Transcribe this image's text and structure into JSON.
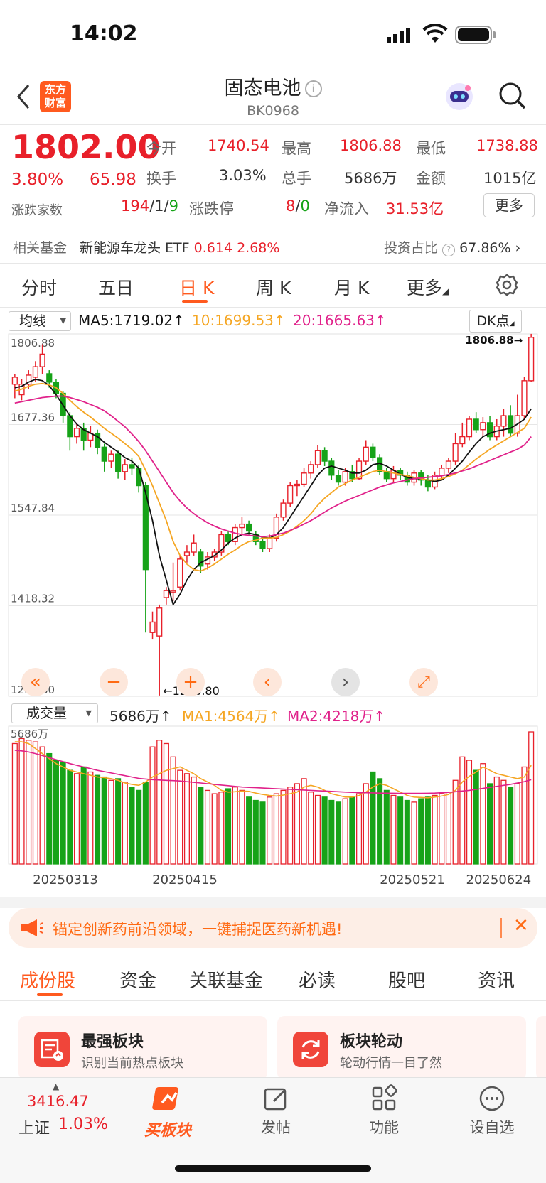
{
  "status_bar": {
    "time": "14:02"
  },
  "header": {
    "logo_line1": "东方",
    "logo_line2": "财富",
    "title": "固态电池",
    "code": "BK0968"
  },
  "quote": {
    "price": "1802.00",
    "change_pct": "3.80%",
    "change": "65.98",
    "open_label": "今开",
    "open": "1740.54",
    "high_label": "最高",
    "high": "1806.88",
    "low_label": "最低",
    "low": "1738.88",
    "turnover_label": "换手",
    "turnover": "3.03%",
    "volume_label": "总手",
    "volume": "5686万",
    "amount_label": "金额",
    "amount": "1015亿",
    "breadth_label": "涨跌家数",
    "breadth_up": "194",
    "breadth_sep1": "/",
    "breadth_flat": "1",
    "breadth_sep2": "/",
    "breadth_down": "9",
    "limit_label": "涨跌停",
    "limit_up": "8",
    "limit_sep": "/",
    "limit_down": "0",
    "netflow_label": "净流入",
    "netflow": "31.53亿",
    "more_button": "更多"
  },
  "fund_row": {
    "label": "相关基金",
    "fund_name": "新能源车龙头 ETF",
    "fund_price": "0.614",
    "fund_change": "2.68%",
    "ratio_label": "投资占比",
    "ratio": "67.86%"
  },
  "period_tabs": [
    "分时",
    "五日",
    "日 K",
    "周 K",
    "月 K",
    "更多"
  ],
  "ma_row": {
    "selector": "均线",
    "ma5": "MA5:1719.02",
    "ma10": "10:1699.53",
    "ma20": "20:1665.63",
    "dk_button": "DK点"
  },
  "vol_row": {
    "selector": "成交量",
    "vol": "5686万",
    "ma1": "MA1:4564万",
    "ma2": "MA2:4218万"
  },
  "colors": {
    "up": "#e8202a",
    "down": "#16a318",
    "ma5": "#111111",
    "ma10": "#f5a623",
    "ma20": "#e0218a",
    "brand": "#ff6a13"
  },
  "chart_data": {
    "type": "candlestick",
    "y_ticks": [
      "1806.88",
      "1677.36",
      "1547.84",
      "1418.32",
      "1288.80"
    ],
    "ylim": [
      1288.8,
      1806.88
    ],
    "high_label": "1806.88",
    "low_label": "1288.80",
    "x_ticks": [
      "20250313",
      "20250415",
      "20250521",
      "20250624"
    ],
    "candles": [
      [
        1735,
        1745,
        1715,
        1750
      ],
      [
        1720,
        1735,
        1712,
        1742
      ],
      [
        1735,
        1748,
        1728,
        1755
      ],
      [
        1745,
        1760,
        1738,
        1768
      ],
      [
        1760,
        1778,
        1750,
        1792
      ],
      [
        1750,
        1738,
        1730,
        1755
      ],
      [
        1738,
        1722,
        1715,
        1742
      ],
      [
        1722,
        1690,
        1680,
        1725
      ],
      [
        1690,
        1660,
        1640,
        1695
      ],
      [
        1660,
        1672,
        1650,
        1680
      ],
      [
        1672,
        1655,
        1640,
        1680
      ],
      [
        1655,
        1665,
        1645,
        1675
      ],
      [
        1665,
        1645,
        1635,
        1670
      ],
      [
        1645,
        1625,
        1610,
        1650
      ],
      [
        1625,
        1635,
        1615,
        1640
      ],
      [
        1635,
        1610,
        1600,
        1640
      ],
      [
        1610,
        1620,
        1598,
        1628
      ],
      [
        1620,
        1615,
        1605,
        1630
      ],
      [
        1615,
        1590,
        1580,
        1620
      ],
      [
        1590,
        1470,
        1380,
        1595
      ],
      [
        1380,
        1395,
        1370,
        1410
      ],
      [
        1375,
        1415,
        1290,
        1420
      ],
      [
        1430,
        1440,
        1420,
        1445
      ],
      [
        1440,
        1440,
        1425,
        1480
      ],
      [
        1445,
        1485,
        1440,
        1490
      ],
      [
        1490,
        1495,
        1480,
        1505
      ],
      [
        1495,
        1508,
        1490,
        1520
      ],
      [
        1495,
        1475,
        1465,
        1500
      ],
      [
        1478,
        1488,
        1470,
        1495
      ],
      [
        1488,
        1495,
        1482,
        1500
      ],
      [
        1495,
        1520,
        1490,
        1525
      ],
      [
        1520,
        1510,
        1505,
        1525
      ],
      [
        1510,
        1530,
        1505,
        1535
      ],
      [
        1530,
        1535,
        1520,
        1545
      ],
      [
        1535,
        1525,
        1520,
        1540
      ],
      [
        1520,
        1510,
        1505,
        1525
      ],
      [
        1510,
        1500,
        1495,
        1515
      ],
      [
        1500,
        1515,
        1495,
        1520
      ],
      [
        1515,
        1545,
        1510,
        1550
      ],
      [
        1545,
        1565,
        1540,
        1570
      ],
      [
        1565,
        1590,
        1560,
        1595
      ],
      [
        1590,
        1592,
        1575,
        1598
      ],
      [
        1592,
        1608,
        1588,
        1615
      ],
      [
        1608,
        1620,
        1600,
        1625
      ],
      [
        1620,
        1640,
        1615,
        1648
      ],
      [
        1640,
        1625,
        1618,
        1645
      ],
      [
        1625,
        1605,
        1598,
        1630
      ],
      [
        1605,
        1595,
        1590,
        1612
      ],
      [
        1595,
        1610,
        1590,
        1615
      ],
      [
        1610,
        1600,
        1595,
        1620
      ],
      [
        1600,
        1625,
        1598,
        1630
      ],
      [
        1625,
        1645,
        1620,
        1655
      ],
      [
        1645,
        1630,
        1625,
        1650
      ],
      [
        1630,
        1610,
        1605,
        1635
      ],
      [
        1610,
        1600,
        1595,
        1615
      ],
      [
        1600,
        1612,
        1595,
        1618
      ],
      [
        1612,
        1605,
        1598,
        1615
      ],
      [
        1605,
        1595,
        1590,
        1610
      ],
      [
        1595,
        1608,
        1590,
        1612
      ],
      [
        1608,
        1598,
        1590,
        1612
      ],
      [
        1598,
        1588,
        1582,
        1605
      ],
      [
        1588,
        1605,
        1585,
        1610
      ],
      [
        1605,
        1615,
        1600,
        1620
      ],
      [
        1615,
        1625,
        1608,
        1630
      ],
      [
        1625,
        1650,
        1620,
        1665
      ],
      [
        1650,
        1660,
        1645,
        1680
      ],
      [
        1660,
        1685,
        1655,
        1690
      ],
      [
        1685,
        1670,
        1665,
        1695
      ],
      [
        1670,
        1680,
        1660,
        1688
      ],
      [
        1680,
        1660,
        1655,
        1690
      ],
      [
        1660,
        1675,
        1655,
        1685
      ],
      [
        1675,
        1690,
        1660,
        1700
      ],
      [
        1690,
        1665,
        1660,
        1705
      ],
      [
        1665,
        1690,
        1660,
        1720
      ],
      [
        1690,
        1740,
        1685,
        1745
      ],
      [
        1740,
        1802,
        1738,
        1807
      ]
    ],
    "ma5": [
      1730,
      1732,
      1738,
      1742,
      1740,
      1733,
      1720,
      1705,
      1690,
      1678,
      1670,
      1665,
      1660,
      1652,
      1645,
      1638,
      1630,
      1625,
      1615,
      1580,
      1540,
      1490,
      1455,
      1420,
      1435,
      1455,
      1470,
      1480,
      1485,
      1490,
      1498,
      1508,
      1515,
      1520,
      1522,
      1520,
      1516,
      1515,
      1520,
      1530,
      1545,
      1560,
      1575,
      1590,
      1605,
      1615,
      1618,
      1615,
      1612,
      1608,
      1608,
      1612,
      1620,
      1622,
      1618,
      1612,
      1606,
      1602,
      1600,
      1600,
      1598,
      1596,
      1598,
      1605,
      1615,
      1625,
      1638,
      1650,
      1660,
      1665,
      1668,
      1670,
      1672,
      1678,
      1685,
      1700
    ],
    "ma10": [
      1725,
      1728,
      1732,
      1735,
      1736,
      1734,
      1730,
      1722,
      1712,
      1703,
      1695,
      1688,
      1680,
      1672,
      1665,
      1658,
      1650,
      1642,
      1632,
      1612,
      1590,
      1565,
      1540,
      1510,
      1490,
      1478,
      1470,
      1468,
      1472,
      1478,
      1485,
      1492,
      1498,
      1505,
      1510,
      1512,
      1515,
      1515,
      1516,
      1520,
      1525,
      1532,
      1540,
      1550,
      1562,
      1572,
      1580,
      1588,
      1593,
      1598,
      1602,
      1606,
      1610,
      1612,
      1610,
      1608,
      1606,
      1604,
      1602,
      1600,
      1598,
      1598,
      1600,
      1603,
      1607,
      1612,
      1620,
      1628,
      1635,
      1642,
      1648,
      1654,
      1660,
      1666,
      1672,
      1688
    ],
    "ma20": [
      1708,
      1710,
      1712,
      1714,
      1716,
      1717,
      1718,
      1718,
      1716,
      1713,
      1710,
      1706,
      1702,
      1697,
      1690,
      1682,
      1674,
      1664,
      1653,
      1640,
      1625,
      1610,
      1595,
      1580,
      1568,
      1558,
      1550,
      1543,
      1537,
      1532,
      1528,
      1525,
      1522,
      1520,
      1519,
      1518,
      1517,
      1518,
      1520,
      1522,
      1526,
      1530,
      1535,
      1540,
      1546,
      1552,
      1558,
      1563,
      1568,
      1572,
      1576,
      1580,
      1584,
      1588,
      1591,
      1594,
      1596,
      1598,
      1600,
      1601,
      1602,
      1603,
      1604,
      1606,
      1608,
      1611,
      1614,
      1618,
      1622,
      1626,
      1630,
      1634,
      1638,
      1642,
      1648,
      1660
    ],
    "volumes": [
      3600,
      3750,
      3700,
      3650,
      3500,
      3300,
      3100,
      3050,
      2800,
      2700,
      2900,
      2750,
      2650,
      2600,
      2500,
      2550,
      2450,
      2300,
      2200,
      2450,
      3500,
      3700,
      3600,
      3200,
      2800,
      2700,
      2600,
      2300,
      2200,
      2100,
      2150,
      2250,
      2300,
      2200,
      2000,
      1900,
      1850,
      2000,
      2100,
      2200,
      2300,
      2400,
      2550,
      2150,
      2050,
      2000,
      1900,
      1850,
      1950,
      2000,
      2100,
      2400,
      2750,
      2550,
      2200,
      2050,
      2000,
      1900,
      1850,
      1950,
      2000,
      2050,
      2100,
      2150,
      2500,
      3200,
      3100,
      2800,
      3000,
      2400,
      2600,
      2500,
      2300,
      2400,
      2900,
      3950
    ],
    "vol_max": 3950,
    "vol_max_label": "5686万",
    "vol_ma1": [
      3650,
      3650,
      3600,
      3450,
      3300,
      3150,
      3000,
      2900,
      2800,
      2750,
      2700,
      2650,
      2600,
      2580,
      2550,
      2500,
      2420,
      2380,
      2350,
      2450,
      2600,
      2700,
      2800,
      2850,
      2900,
      2800,
      2700,
      2550,
      2450,
      2350,
      2200,
      2150,
      2160,
      2180,
      2170,
      2120,
      2080,
      2050,
      2030,
      2060,
      2100,
      2150,
      2300,
      2350,
      2300,
      2200,
      2100,
      2050,
      2000,
      2000,
      2050,
      2150,
      2300,
      2400,
      2350,
      2250,
      2150,
      2050,
      2000,
      1990,
      1980,
      2000,
      2030,
      2080,
      2200,
      2450,
      2620,
      2750,
      2900,
      2800,
      2700,
      2650,
      2600,
      2550,
      2600,
      2950
    ],
    "vol_ma2": [
      3400,
      3380,
      3350,
      3300,
      3240,
      3180,
      3120,
      3060,
      3000,
      2950,
      2900,
      2850,
      2800,
      2760,
      2720,
      2680,
      2640,
      2600,
      2560,
      2540,
      2520,
      2510,
      2500,
      2490,
      2480,
      2460,
      2440,
      2420,
      2400,
      2380,
      2360,
      2340,
      2320,
      2300,
      2290,
      2280,
      2270,
      2260,
      2250,
      2240,
      2230,
      2220,
      2210,
      2200,
      2190,
      2180,
      2170,
      2160,
      2150,
      2140,
      2135,
      2130,
      2125,
      2120,
      2118,
      2116,
      2114,
      2112,
      2110,
      2110,
      2115,
      2120,
      2130,
      2140,
      2160,
      2180,
      2200,
      2230,
      2260,
      2290,
      2320,
      2350,
      2380,
      2420,
      2460,
      2520
    ]
  },
  "chart_controls": [
    "«",
    "−",
    "+",
    "‹",
    "›",
    "⤢"
  ],
  "banner": {
    "text": "锚定创新药前沿领域，一键捕捉医药新机遇!"
  },
  "section_tabs": [
    "成份股",
    "资金",
    "关联基金",
    "必读",
    "股吧",
    "资讯"
  ],
  "cards": [
    {
      "title": "最强板块",
      "subtitle": "识别当前热点板块"
    },
    {
      "title": "板块轮动",
      "subtitle": "轮动行情一目了然"
    }
  ],
  "bottom_bar": {
    "index_value": "3416.47",
    "index_name": "上证",
    "index_change": "1.03%",
    "items": [
      "买板块",
      "发帖",
      "功能",
      "设自选"
    ]
  }
}
